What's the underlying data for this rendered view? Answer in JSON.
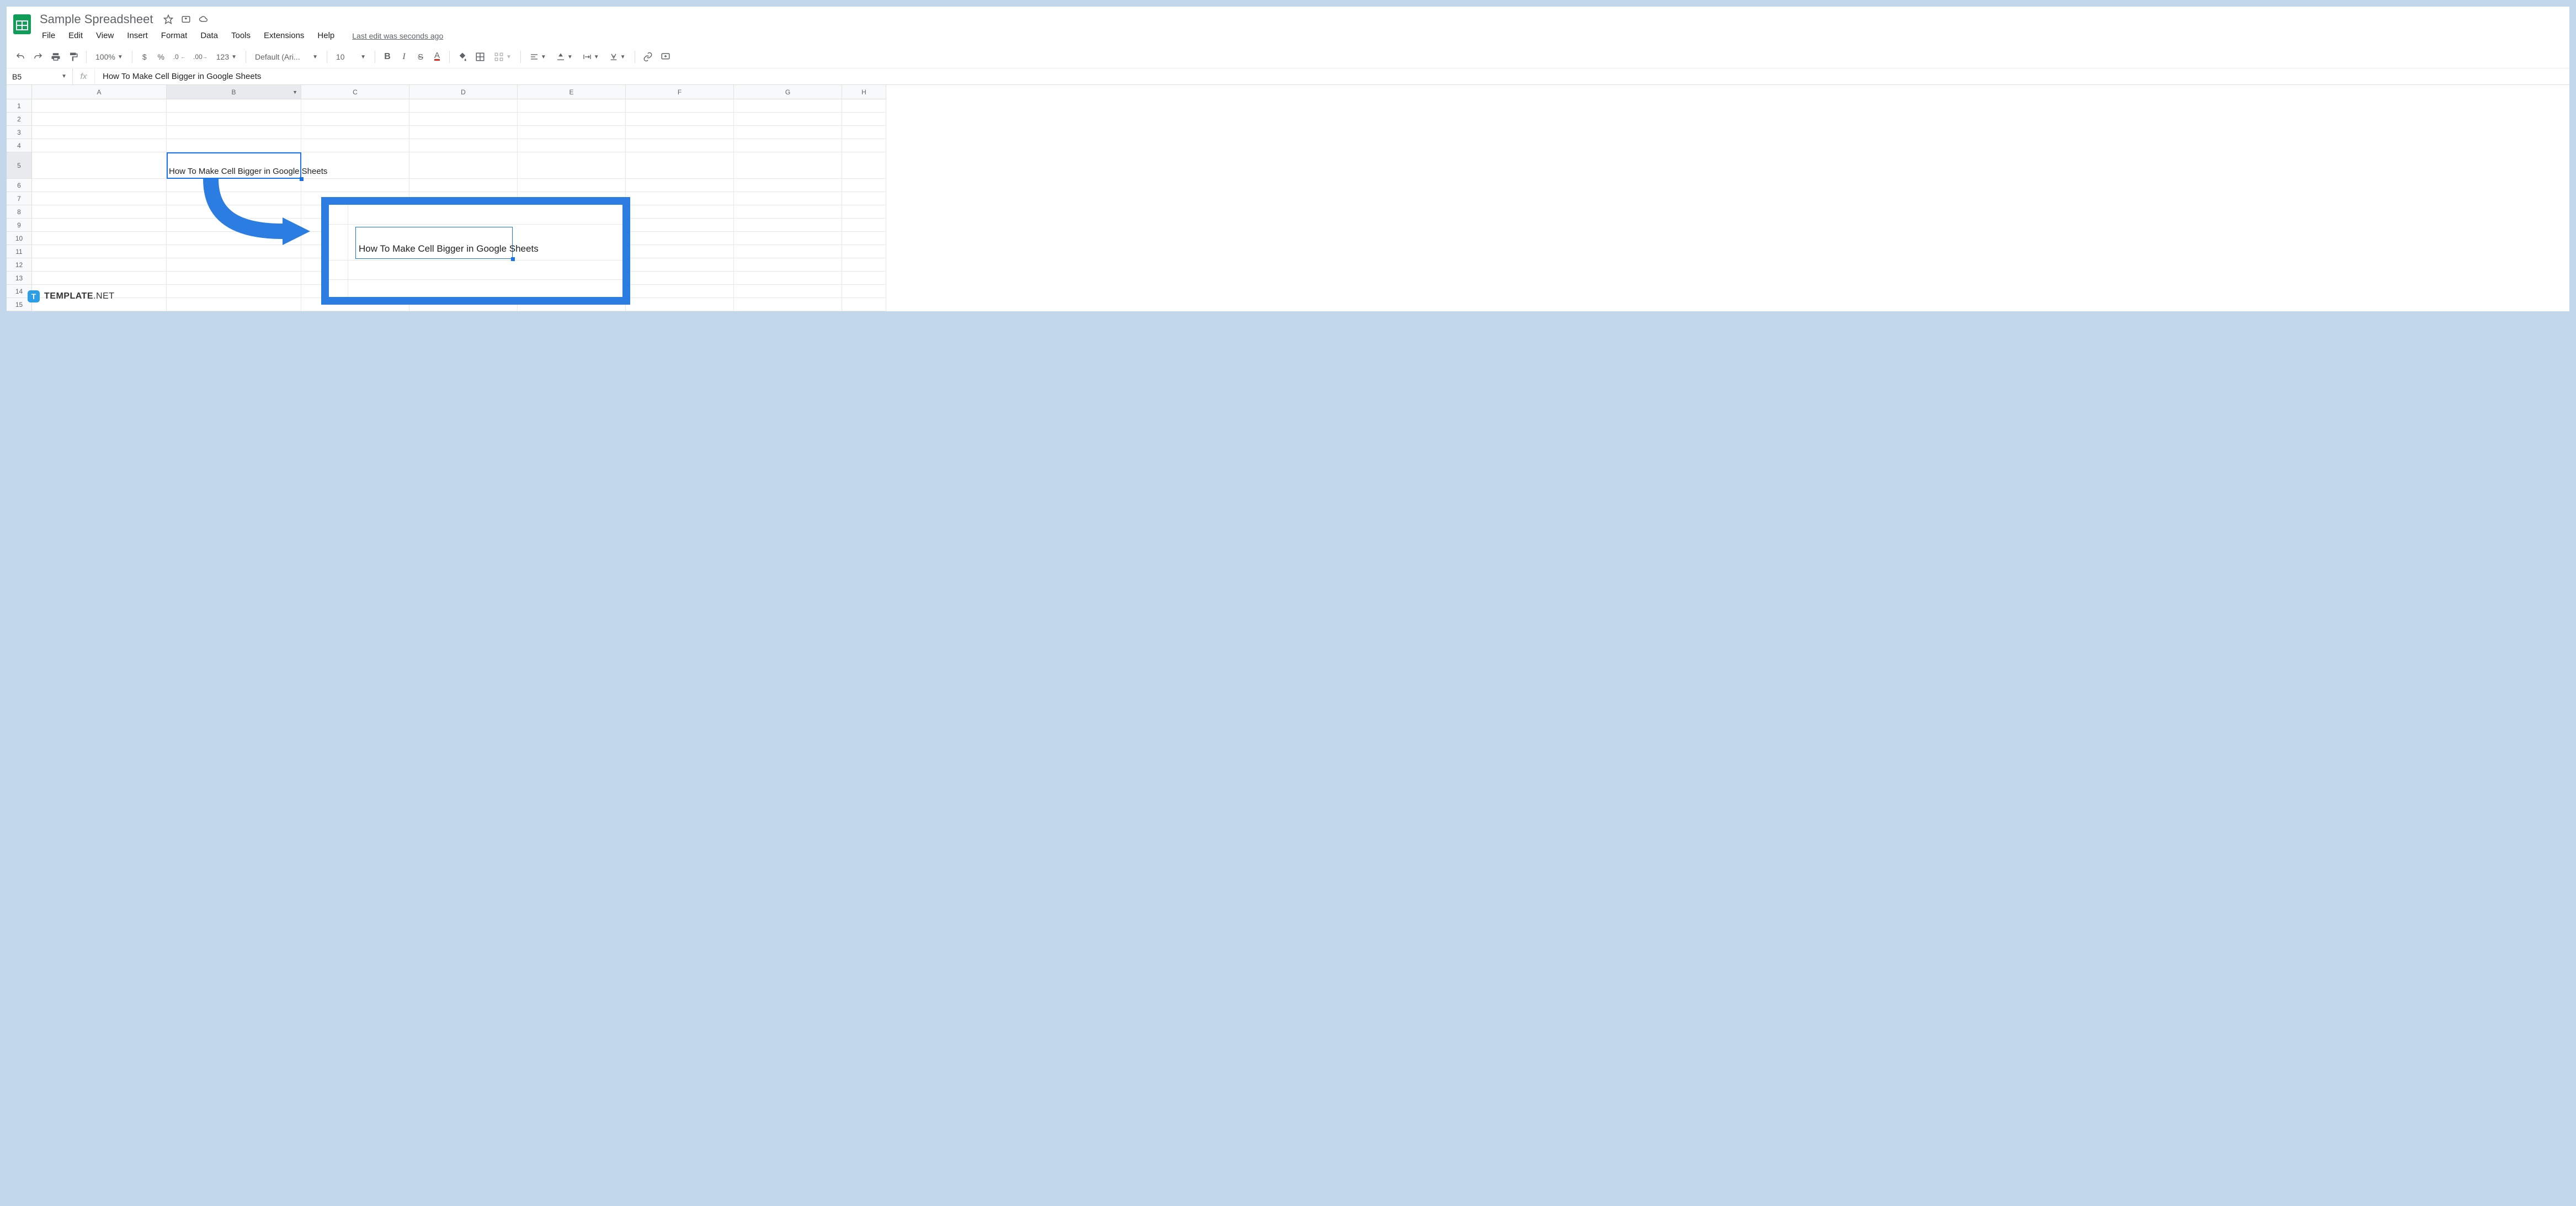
{
  "doc": {
    "title": "Sample Spreadsheet"
  },
  "menubar": [
    "File",
    "Edit",
    "View",
    "Insert",
    "Format",
    "Data",
    "Tools",
    "Extensions",
    "Help"
  ],
  "last_edit": "Last edit was seconds ago",
  "toolbar": {
    "zoom": "100%",
    "currency": "$",
    "percent": "%",
    "dec_dec": ".0",
    "inc_dec": ".00",
    "more_fmt": "123",
    "font": "Default (Ari...",
    "size": "10"
  },
  "namebox": "B5",
  "formula": "How To Make Cell Bigger in Google Sheets",
  "columns": [
    "A",
    "B",
    "C",
    "D",
    "E",
    "F",
    "G",
    "H"
  ],
  "rows": [
    "1",
    "2",
    "3",
    "4",
    "5",
    "6",
    "7",
    "8",
    "9",
    "10",
    "11",
    "12",
    "13",
    "14",
    "15"
  ],
  "selected_col": "B",
  "selected_row": "5",
  "cell_b5": "How To Make Cell Bigger in Google Sheets",
  "callout_text": "How To Make Cell Bigger in Google Sheets",
  "watermark": {
    "logo": "T",
    "text": "TEMPLATE",
    "suffix": ".NET"
  }
}
